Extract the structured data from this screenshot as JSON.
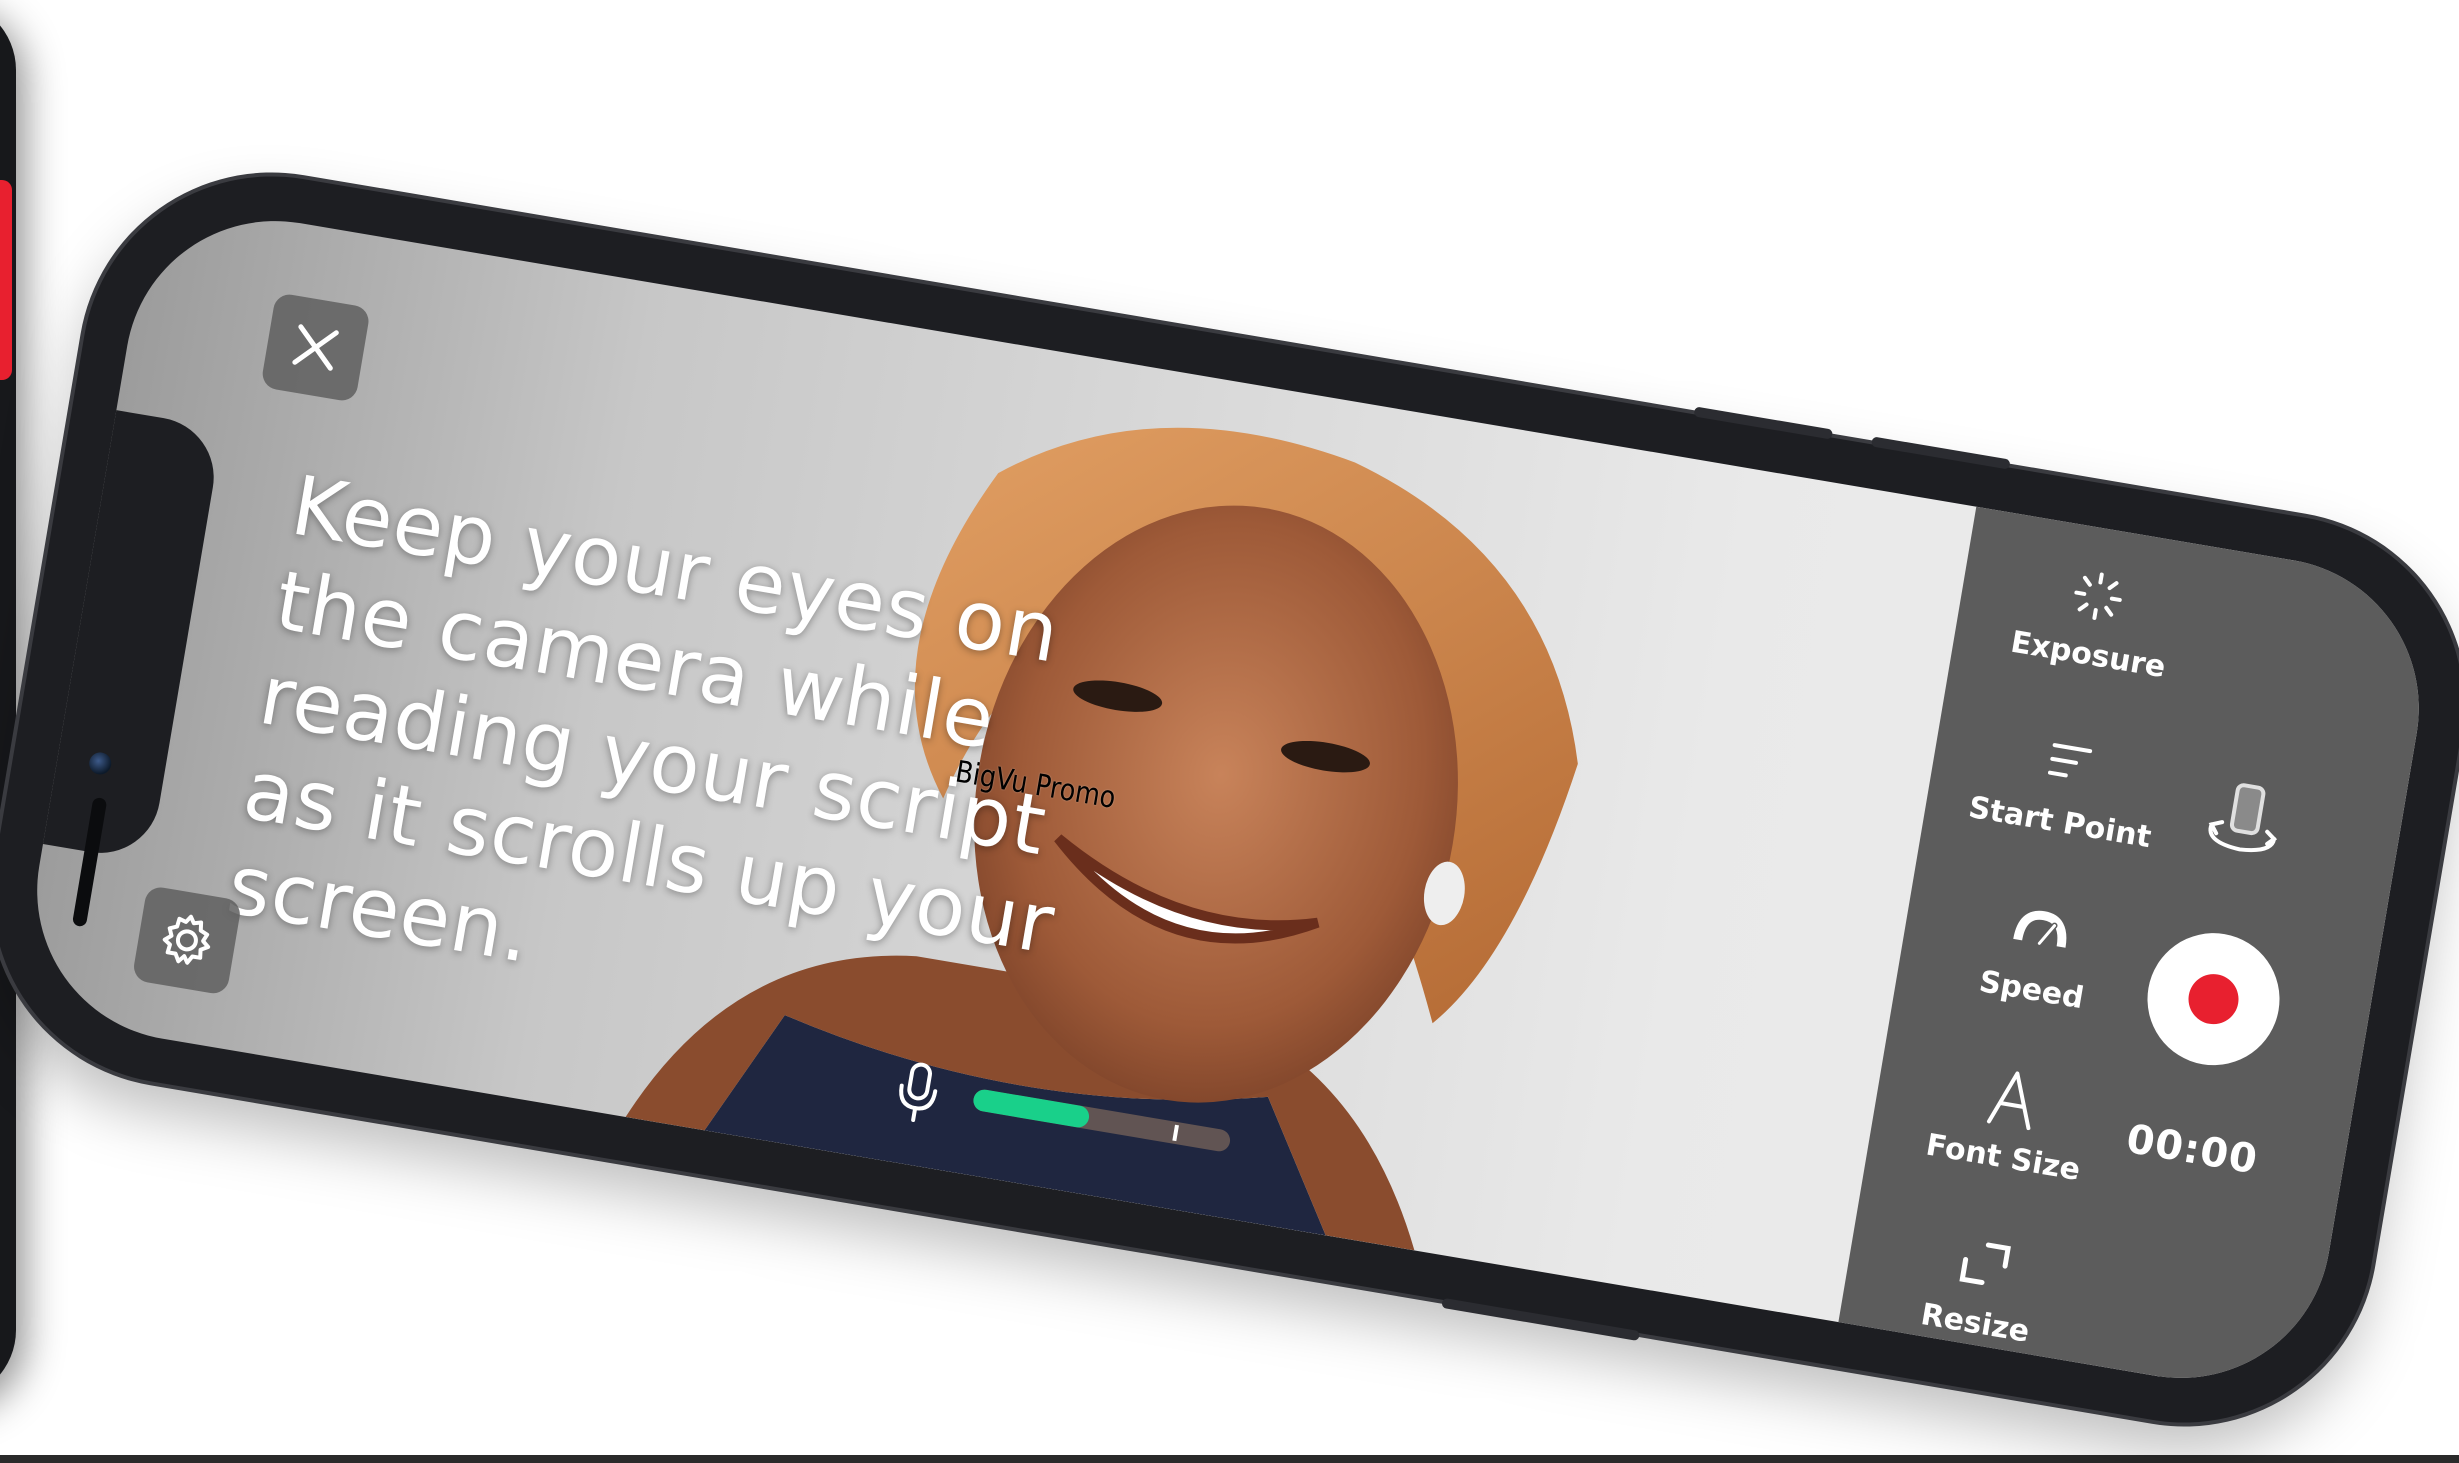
{
  "teleprompter": {
    "script_lines": [
      "Keep your eyes on",
      "the camera while",
      "reading your script",
      "as it scrolls up your",
      "screen."
    ]
  },
  "watermark": {
    "text": "BigVu Promo"
  },
  "controls": {
    "exposure_label": "Exposure",
    "start_point_label": "Start Point",
    "speed_label": "Speed",
    "font_size_label": "Font Size",
    "resize_label": "Resize"
  },
  "recording": {
    "timer": "00:00"
  },
  "audio_level": {
    "level": 0.45,
    "peak": 0.78
  },
  "icons": {
    "close": "close-icon",
    "settings": "gear-icon",
    "mic": "microphone-icon",
    "exposure": "exposure-icon",
    "start_point": "start-point-icon",
    "speed": "speedometer-icon",
    "font_size": "font-size-icon",
    "resize": "resize-icon",
    "flip": "flip-camera-icon",
    "record": "record-icon"
  },
  "colors": {
    "record": "#e8202f",
    "level_fill": "#19d08a",
    "panel": "#5c5c5c"
  }
}
